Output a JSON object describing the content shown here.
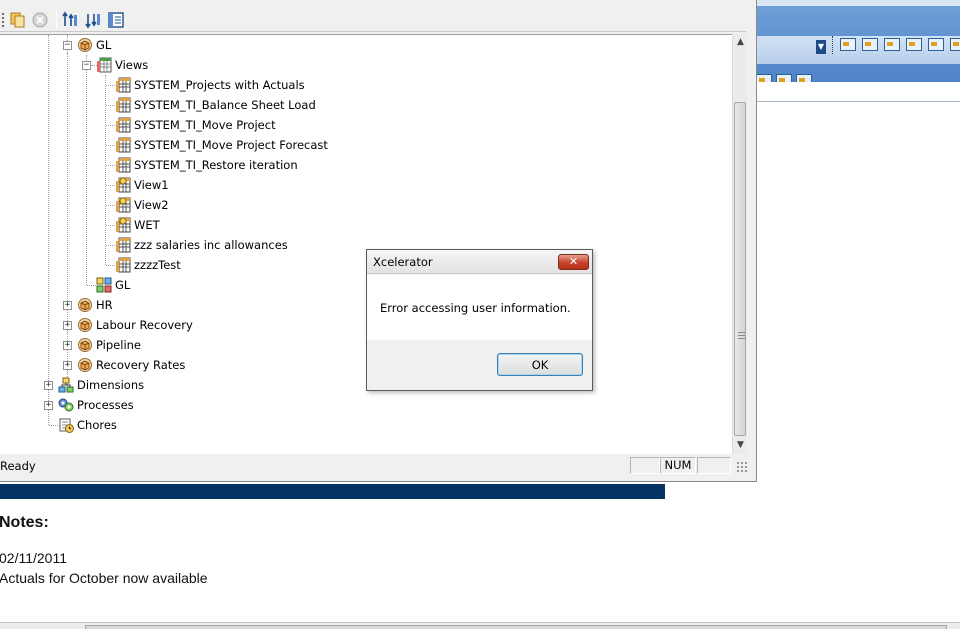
{
  "toolbar": {
    "buttons": [
      "copy-icon",
      "cancel-icon",
      "sort-ascending-icon",
      "sort-descending-icon",
      "properties-icon"
    ]
  },
  "tree": {
    "nodes": [
      {
        "id": "gl-cube",
        "label": "GL",
        "icon": "cube-icon"
      },
      {
        "id": "views-folder",
        "label": "Views",
        "icon": "views-folder-icon"
      },
      {
        "id": "view-1",
        "label": "SYSTEM_Projects with Actuals",
        "icon": "view-icon"
      },
      {
        "id": "view-2",
        "label": "SYSTEM_TI_Balance Sheet Load",
        "icon": "view-icon"
      },
      {
        "id": "view-3",
        "label": "SYSTEM_TI_Move Project",
        "icon": "view-icon"
      },
      {
        "id": "view-4",
        "label": "SYSTEM_TI_Move Project Forecast",
        "icon": "view-icon"
      },
      {
        "id": "view-5",
        "label": "SYSTEM_TI_Restore iteration",
        "icon": "view-icon"
      },
      {
        "id": "view-6",
        "label": "View1",
        "icon": "private-view-icon"
      },
      {
        "id": "view-7",
        "label": "View2",
        "icon": "private-view-icon"
      },
      {
        "id": "view-8",
        "label": "WET",
        "icon": "private-view-icon"
      },
      {
        "id": "view-9",
        "label": "zzz salaries inc allowances",
        "icon": "view-icon"
      },
      {
        "id": "view-10",
        "label": "zzzzTest",
        "icon": "view-icon"
      },
      {
        "id": "gl-subsets",
        "label": "GL",
        "icon": "dimension-icon"
      },
      {
        "id": "hr-cube",
        "label": "HR",
        "icon": "cube-icon"
      },
      {
        "id": "labour-cube",
        "label": "Labour Recovery",
        "icon": "cube-icon"
      },
      {
        "id": "pipeline-cube",
        "label": "Pipeline",
        "icon": "cube-icon"
      },
      {
        "id": "recovery-cube",
        "label": "Recovery Rates",
        "icon": "cube-icon"
      },
      {
        "id": "dimensions",
        "label": "Dimensions",
        "icon": "dimensions-icon"
      },
      {
        "id": "processes",
        "label": "Processes",
        "icon": "processes-icon"
      },
      {
        "id": "chores",
        "label": "Chores",
        "icon": "chores-icon"
      }
    ]
  },
  "status": {
    "text": "Ready",
    "num": "NUM"
  },
  "notes": {
    "title": "Notes:",
    "date": "02/11/2011",
    "text": "Actuals for October now available"
  },
  "dialog": {
    "title": "Xcelerator",
    "close": "✕",
    "message": "Error accessing user information.",
    "ok": "OK"
  },
  "colors": {
    "notes_bar": "#053464",
    "ribbon": "#4f84c8"
  }
}
